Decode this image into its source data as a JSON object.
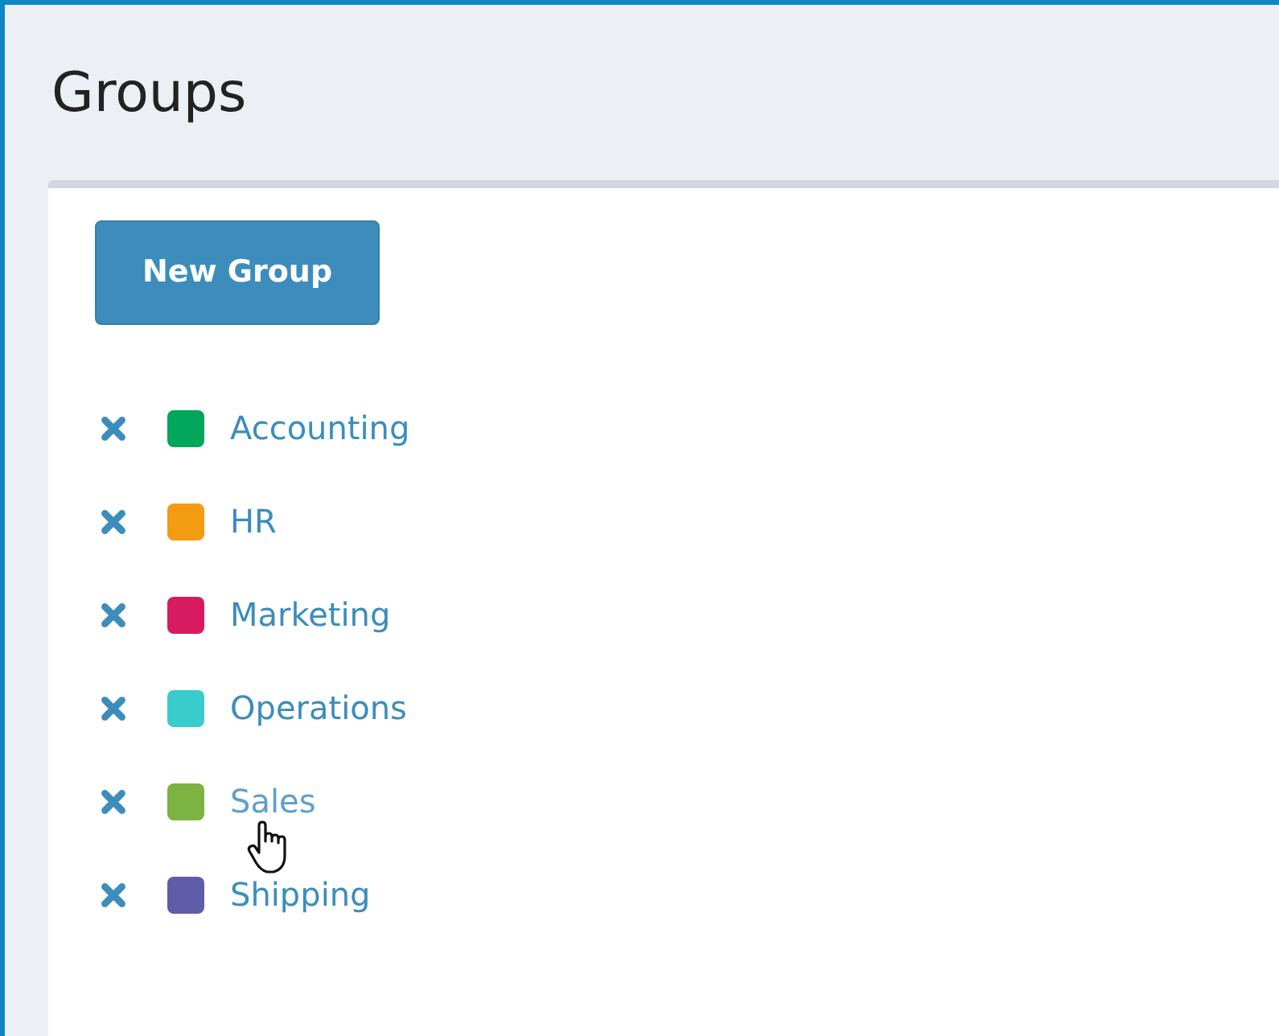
{
  "page": {
    "title": "Groups"
  },
  "new_button": {
    "label": "New Group"
  },
  "groups": [
    {
      "name": "Accounting",
      "color": "#00a65a",
      "hovered": false
    },
    {
      "name": "HR",
      "color": "#f39c12",
      "hovered": false
    },
    {
      "name": "Marketing",
      "color": "#d81b60",
      "hovered": false
    },
    {
      "name": "Operations",
      "color": "#39cccc",
      "hovered": false
    },
    {
      "name": "Sales",
      "color": "#7cb342",
      "hovered": true
    },
    {
      "name": "Shipping",
      "color": "#605ca8",
      "hovered": false
    }
  ]
}
